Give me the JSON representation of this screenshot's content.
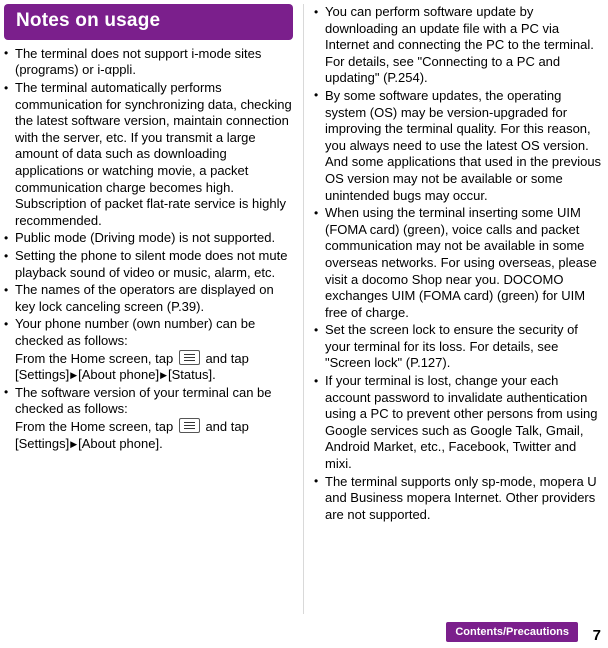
{
  "banner": {
    "title": "Notes on usage"
  },
  "left_column": {
    "items": [
      {
        "text": "The terminal does not support i-mode sites (programs) or i-αppli."
      },
      {
        "text": "The terminal automatically performs communication for synchronizing data, checking the latest software version, maintain connection with the server, etc. If you transmit a large amount of data such as downloading applications or watching movie, a packet communication charge becomes high. Subscription of packet flat-rate service is highly recommended."
      },
      {
        "text": "Public mode (Driving mode) is not supported."
      },
      {
        "text": "Setting the phone to silent mode does not mute playback sound of video or music, alarm, etc."
      },
      {
        "text": "The names of the operators are displayed on key lock canceling screen (P.39)."
      },
      {
        "segments": [
          {
            "type": "text",
            "value": "Your phone number (own number) can be checked as follows:"
          },
          {
            "type": "break"
          },
          {
            "type": "text",
            "value": "From the Home screen, tap "
          },
          {
            "type": "key",
            "value": "menu-key-icon"
          },
          {
            "type": "text",
            "value": " and tap [Settings]"
          },
          {
            "type": "arrow",
            "value": "▶"
          },
          {
            "type": "text",
            "value": "[About phone]"
          },
          {
            "type": "arrow",
            "value": "▶"
          },
          {
            "type": "text",
            "value": "[Status]."
          }
        ]
      },
      {
        "segments": [
          {
            "type": "text",
            "value": "The software version of your terminal can be checked as follows:"
          },
          {
            "type": "break"
          },
          {
            "type": "text",
            "value": "From the Home screen, tap "
          },
          {
            "type": "key",
            "value": "menu-key-icon"
          },
          {
            "type": "text",
            "value": " and tap [Settings]"
          },
          {
            "type": "arrow",
            "value": "▶"
          },
          {
            "type": "text",
            "value": "[About phone]."
          }
        ]
      }
    ]
  },
  "right_column": {
    "items": [
      {
        "text": "You can perform software update by downloading an update file with a PC via Internet and connecting the PC to the terminal. For details, see \"Connecting to a PC and updating\" (P.254)."
      },
      {
        "text": "By some software updates, the operating system (OS) may be version-upgraded for improving the terminal quality. For this reason, you always need to use the latest OS version. And some applications that used in the previous OS version may not be available or some unintended bugs may occur."
      },
      {
        "text": "When using the terminal inserting some UIM (FOMA card) (green), voice calls and packet communication may not be available in some overseas networks. For using overseas, please visit a docomo Shop near you. DOCOMO exchanges UIM (FOMA card) (green) for UIM free of charge."
      },
      {
        "text": "Set the screen lock to ensure the security of your terminal for its loss. For details, see \"Screen lock\" (P.127)."
      },
      {
        "text": "If your terminal is lost, change your each account password to invalidate authentication using a PC to prevent other persons from using Google services such as Google Talk, Gmail, Android Market, etc., Facebook, Twitter and mixi."
      },
      {
        "text": "The terminal supports only sp-mode, mopera U and Business mopera Internet. Other providers are not supported."
      }
    ]
  },
  "footer": {
    "label": "Contents/Precautions",
    "page_number": "7"
  },
  "colors": {
    "accent": "#7b1f8c",
    "text": "#000000",
    "divider": "#d9d9d9"
  }
}
